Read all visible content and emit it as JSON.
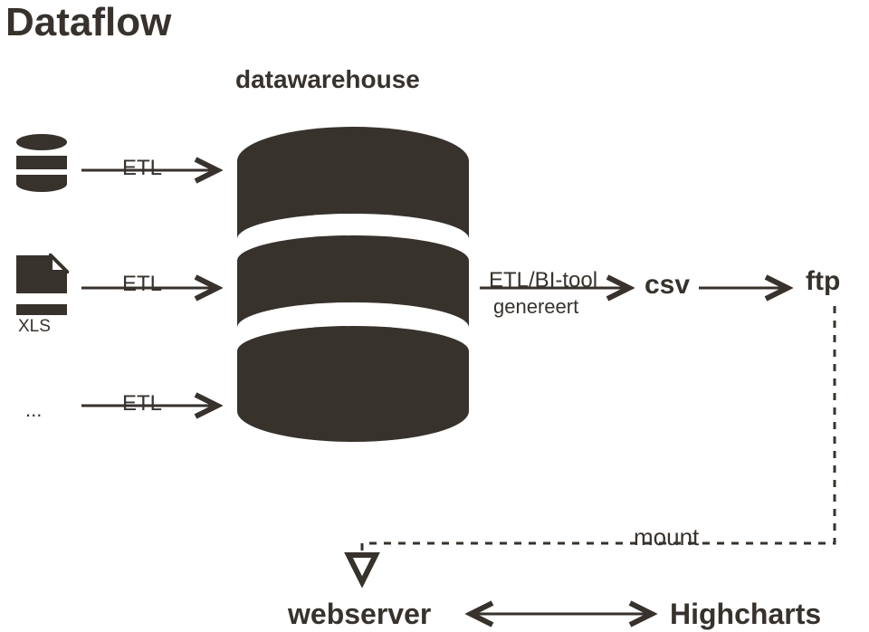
{
  "title": "Dataflow",
  "subtitle": "datawarehouse",
  "sources": {
    "db_small": "database-icon",
    "file": {
      "icon": "file-icon",
      "label": "XLS"
    },
    "ellipsis": "..."
  },
  "arrows": {
    "etl1": "ETL",
    "etl2": "ETL",
    "etl3": "ETL",
    "etl_bi_line1": "ETL/BI-tool",
    "etl_bi_line2": "genereert",
    "mount": "mount"
  },
  "nodes": {
    "csv": "csv",
    "ftp": "ftp",
    "webserver": "webserver",
    "highcharts": "Highcharts"
  },
  "color": "#38322d"
}
